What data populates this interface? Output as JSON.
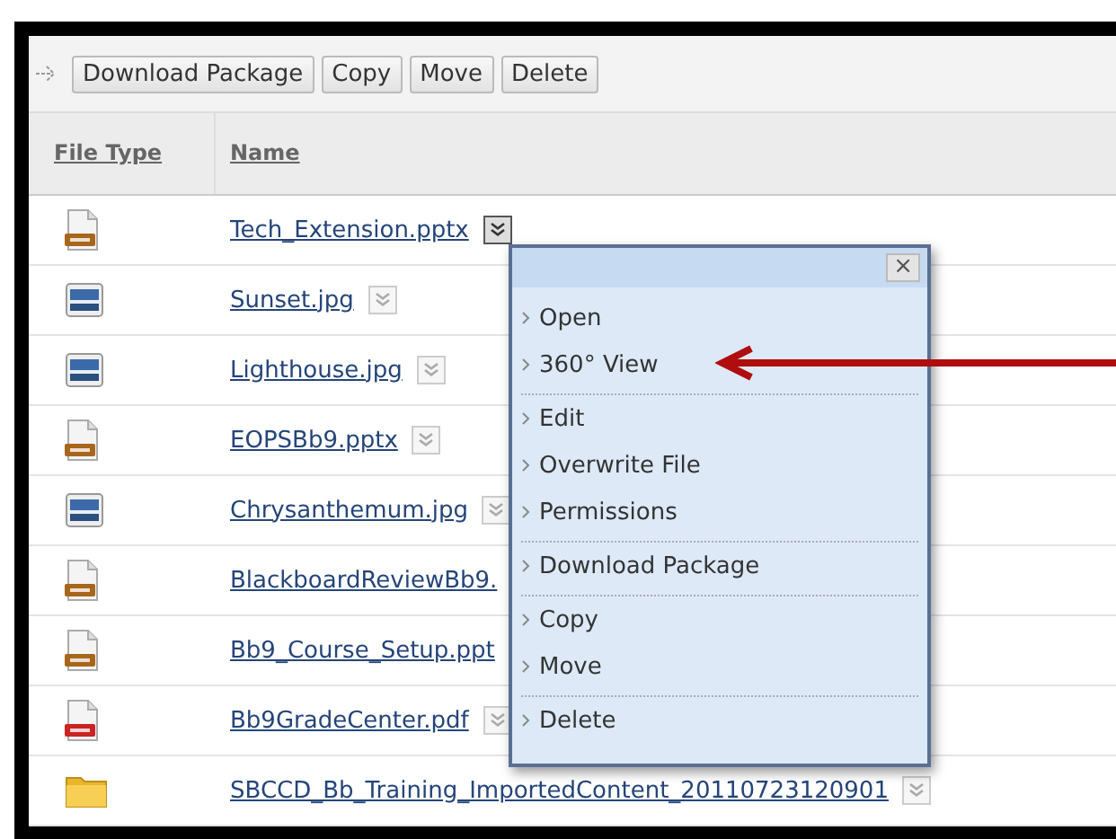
{
  "toolbar": {
    "buttons": [
      "Download Package",
      "Copy",
      "Move",
      "Delete"
    ]
  },
  "table": {
    "columns": [
      "File Type",
      "Name"
    ],
    "rows": [
      {
        "kind": "ppt",
        "name": "Tech_Extension.pptx",
        "menu_button": true,
        "hovered": true
      },
      {
        "kind": "image",
        "name": "Sunset.jpg",
        "menu_button": true,
        "hovered": false
      },
      {
        "kind": "image",
        "name": "Lighthouse.jpg",
        "menu_button": true,
        "hovered": false
      },
      {
        "kind": "ppt",
        "name": "EOPSBb9.pptx",
        "menu_button": true,
        "hovered": false
      },
      {
        "kind": "image",
        "name": "Chrysanthemum.jpg",
        "menu_button": true,
        "hovered": false
      },
      {
        "kind": "ppt",
        "name": "BlackboardReviewBb9."
      },
      {
        "kind": "ppt",
        "name": "Bb9_Course_Setup.ppt"
      },
      {
        "kind": "pdf",
        "name": "Bb9GradeCenter.pdf",
        "menu_button": true,
        "hovered": false
      },
      {
        "kind": "folder",
        "name": "SBCCD_Bb_Training_ImportedContent_20110723120901",
        "menu_button": true,
        "hovered": false
      }
    ]
  },
  "context_menu": {
    "close": "×",
    "groups": [
      [
        "Open",
        "360° View"
      ],
      [
        "Edit",
        "Overwrite File",
        "Permissions"
      ],
      [
        "Download Package"
      ],
      [
        "Copy",
        "Move"
      ],
      [
        "Delete"
      ]
    ]
  }
}
